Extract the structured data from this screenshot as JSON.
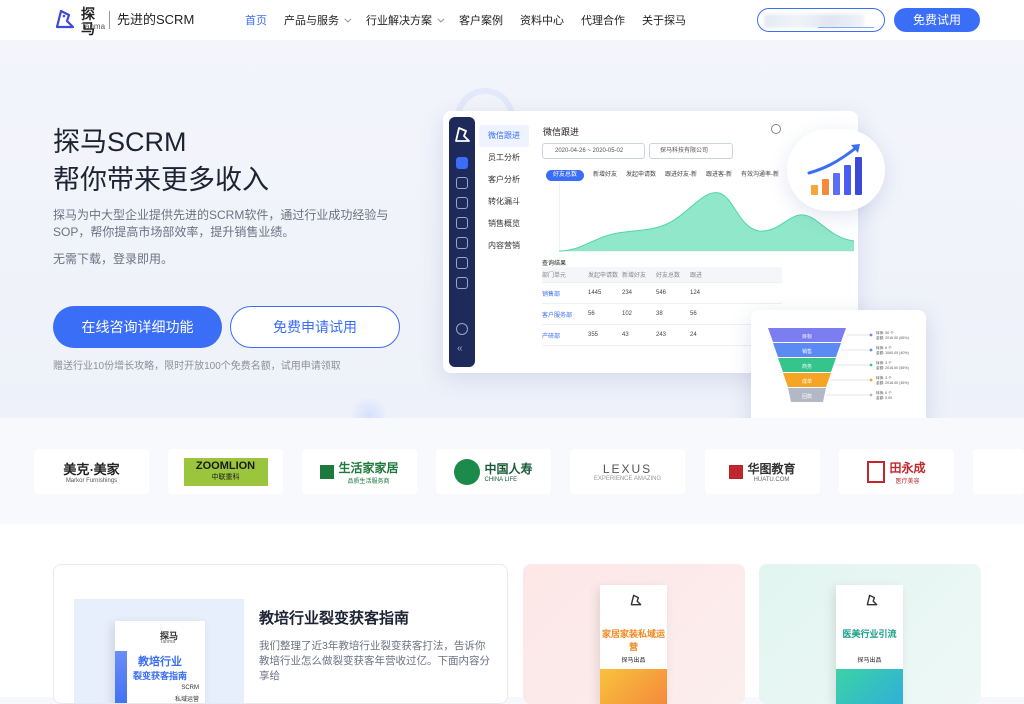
{
  "nav": {
    "logo_cn": "探马",
    "logo_en": "Tanma",
    "slogan": "先进的SCRM",
    "items": [
      {
        "label": "首页",
        "active": true,
        "dropdown": false
      },
      {
        "label": "产品与服务",
        "active": false,
        "dropdown": true
      },
      {
        "label": "行业解决方案",
        "active": false,
        "dropdown": true
      },
      {
        "label": "客户案例",
        "active": false,
        "dropdown": false
      },
      {
        "label": "资料中心",
        "active": false,
        "dropdown": false
      },
      {
        "label": "代理合作",
        "active": false,
        "dropdown": false
      },
      {
        "label": "关于探马",
        "active": false,
        "dropdown": false
      }
    ],
    "trial_label": "免费试用"
  },
  "hero": {
    "title_line1": "探马SCRM",
    "title_line2": "帮你带来更多收入",
    "description": "探马为中大型企业提供先进的SCRM软件，通过行业成功经验与SOP，帮你提高市场部效率，提升销售业绩。",
    "note": "无需下载，登录即用。",
    "primary_button": "在线咨询详细功能",
    "secondary_button": "免费申请试用",
    "tip": "赠送行业10份增长攻略，限时开放100个免费名额，试用申请领取"
  },
  "dashboard": {
    "menu": [
      "微信跟进",
      "员工分析",
      "客户分析",
      "转化漏斗",
      "销售概览",
      "内容营销"
    ],
    "title": "微信跟进",
    "date_range": "2020-04-26 ~ 2020-05-02",
    "company": "探马科技有限公司",
    "tabs": [
      "好友总数",
      "新增好友",
      "发起申请数",
      "跟进好友-新",
      "跟进客-新",
      "有效沟通率-新"
    ],
    "query_label": "查询结果",
    "table_headers": [
      "部门单元",
      "发起申请数",
      "新增好友",
      "好友总数",
      "跟进"
    ],
    "table_rows": [
      [
        "销售部",
        "1445",
        "234",
        "546",
        "124"
      ],
      [
        "客户服务部",
        "56",
        "102",
        "38",
        "56"
      ],
      [
        "产研部",
        "355",
        "43",
        "243",
        "24"
      ]
    ],
    "funnel_levels": [
      "目标",
      "销售",
      "商务",
      "成单",
      "回款"
    ],
    "funnel_notes": [
      [
        "转换: 50 个",
        "金额: 2016.00 (65%)"
      ],
      [
        "转换: 6 个",
        "金额: 1060.00 (40%)"
      ],
      [
        "转换: 3 个",
        "金额: 2016.00 (55%)"
      ],
      [
        "转换: 3 个",
        "金额: 2016.00 (35%)"
      ],
      [
        "转换: 0 个",
        "金额: 0.00"
      ]
    ]
  },
  "logos": [
    {
      "name": "美克·美家",
      "sub": "Markor Furnishings"
    },
    {
      "name": "ZOOMLION",
      "sub": "中联重科"
    },
    {
      "name": "生活家家居",
      "sub": "品质生活服务商"
    },
    {
      "name": "中国人寿",
      "sub": "CHINA LIFE"
    },
    {
      "name": "LEXUS",
      "sub": "EXPERIENCE AMAZING"
    },
    {
      "name": "华图教育",
      "sub": "HUATU.COM"
    },
    {
      "name": "田永成",
      "sub": "医疗美容"
    }
  ],
  "cards": {
    "main_title": "教培行业裂变获客指南",
    "main_desc": "我们整理了近3年教培行业裂变获客打法，告诉你教培行业怎么做裂变获客年营收过亿。下面内容分享给",
    "book_brand": "探马",
    "book_brand_en": "Tanma",
    "book_title_1": "教培行业",
    "book_title_2": "裂变获客指南",
    "book_sub_1": "SCRM",
    "book_sub_2": "私域运营",
    "pink_book_title": "家居家装私域运营",
    "pink_book_sub": "探马出品",
    "mint_book_title": "医美行业引流",
    "mint_book_sub": "探马出品"
  },
  "colors": {
    "brand": "#3b6ef6",
    "sidebar": "#1e2a5a",
    "chart_green": "#4fd8a5"
  }
}
